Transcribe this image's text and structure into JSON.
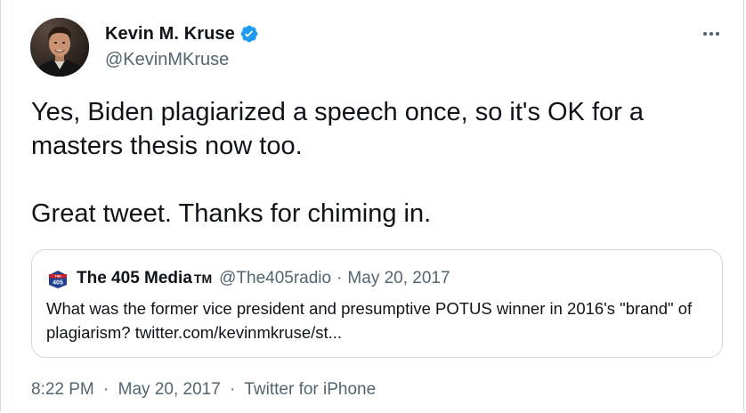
{
  "author": {
    "display_name": "Kevin M. Kruse",
    "handle": "@KevinMKruse",
    "verified_color": "#1d9bf0"
  },
  "tweet": {
    "paragraphs": [
      "Yes, Biden plagiarized a speech once, so it's OK for a masters thesis now too.",
      "Great tweet. Thanks for chiming in."
    ]
  },
  "quoted": {
    "display_name": "The 405 Media",
    "tm_mark": "TM",
    "handle": "@The405radio",
    "separator": "·",
    "date": "May 20, 2017",
    "text": "What was the former vice president and presumptive POTUS winner in 2016's \"brand\" of plagiarism? twitter.com/kevinmkruse/st...",
    "avatar_top_label": "THE",
    "avatar_number": "405"
  },
  "footer": {
    "time": "8:22 PM",
    "separator": "·",
    "date": "May 20, 2017",
    "source": "Twitter for iPhone"
  },
  "colors": {
    "text_primary": "#0f1419",
    "text_secondary": "#536471",
    "border": "#cfd9de",
    "brand_blue": "#1d9bf0"
  },
  "icons": {
    "verified": "verified-badge-icon",
    "more": "more-options-icon"
  }
}
